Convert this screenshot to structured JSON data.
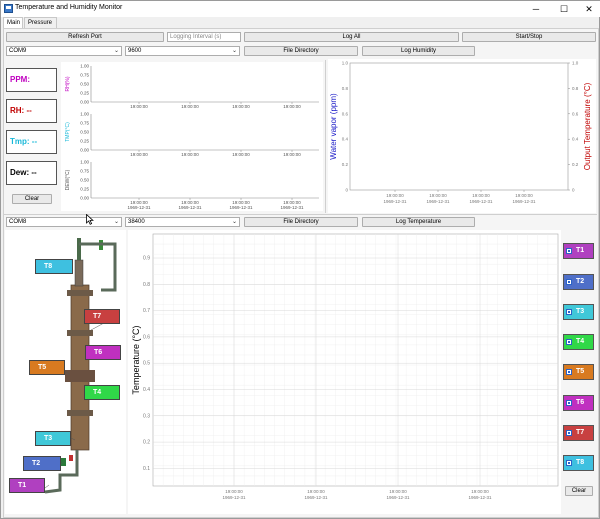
{
  "window": {
    "title": "Temperature and Humidity Monitor",
    "minimize": "─",
    "maximize": "☐",
    "close": "✕"
  },
  "tabs": [
    {
      "label": "Main"
    },
    {
      "label": "Pressure"
    }
  ],
  "toolbar": {
    "refresh_port": "Refresh Port",
    "logging_interval_placeholder": "Logging Interval (s)",
    "log_all": "Log All",
    "start_stop": "Start/Stop"
  },
  "humidity": {
    "port": "COM9",
    "baud": "9600",
    "file_directory": "File Directory",
    "log_button": "Log Humidity",
    "readouts": [
      {
        "label": "PPM:",
        "color": "#c000c0"
      },
      {
        "label": "RH: --",
        "color": "#c00000"
      },
      {
        "label": "Tmp: --",
        "color": "#18b8d8"
      },
      {
        "label": "Dew: --",
        "color": "#000000"
      }
    ],
    "clear": "Clear",
    "small_plots": [
      {
        "ylabel": "RH(%)",
        "ylabel_color": "#c000c0",
        "yticks": [
          "1.00",
          "0.75",
          "0.50",
          "0.25",
          "0.00"
        ],
        "xticks": [
          "19:00:00",
          "19:00:00",
          "19:00:00",
          "19:00:00"
        ],
        "xdate": ""
      },
      {
        "ylabel": "TMP(°C)",
        "ylabel_color": "#18b8d8",
        "yticks": [
          "1.00",
          "0.75",
          "0.50",
          "0.25",
          "0.00"
        ],
        "xticks": [
          "19:00:00",
          "19:00:00",
          "19:00:00",
          "19:00:00"
        ],
        "xdate": ""
      },
      {
        "ylabel": "DEW(°C)",
        "ylabel_color": "#555555",
        "yticks": [
          "1.00",
          "0.75",
          "0.50",
          "0.25",
          "0.00"
        ],
        "xticks": [
          "19:00:00",
          "19:00:00",
          "19:00:00",
          "19:00:00"
        ],
        "xdate": "1969-12-31"
      }
    ],
    "right_plot": {
      "left_label": "Water vapor (ppm)",
      "left_color": "#1c1cc8",
      "right_label": "Output Temperature (°C)",
      "right_color": "#c00000",
      "yticks_left": [
        "1.0",
        "0.8",
        "0.6",
        "0.4",
        "0.2",
        "0"
      ],
      "yticks_right": [
        "1.0",
        "0.8",
        "0.6",
        "0.4",
        "0.2",
        "0"
      ],
      "xticks": [
        "19:00:00",
        "19:00:00",
        "19:00:00",
        "19:00:00"
      ],
      "xdate": "1969-12-31"
    }
  },
  "temperature": {
    "port": "COM8",
    "baud": "38400",
    "file_directory": "File Directory",
    "log_button": "Log Temperature",
    "ylabel": "Temperature (°C)",
    "yticks": [
      "0.9",
      "0.8",
      "0.7",
      "0.6",
      "0.5",
      "0.4",
      "0.3",
      "0.2",
      "0.1"
    ],
    "xticks": [
      "19:00:00",
      "19:00:00",
      "19:00:00",
      "19:00:00"
    ],
    "xdate": "1969-12-31",
    "clear": "Clear",
    "sensor_labels": [
      {
        "label": "T8",
        "color": "#3ec0e0"
      },
      {
        "label": "T7",
        "color": "#c84040"
      },
      {
        "label": "T6",
        "color": "#c030c0"
      },
      {
        "label": "T5",
        "color": "#d87a20"
      },
      {
        "label": "T4",
        "color": "#30d848"
      },
      {
        "label": "T3",
        "color": "#40c8d8"
      },
      {
        "label": "T2",
        "color": "#4f6fc8"
      },
      {
        "label": "T1",
        "color": "#b040c0"
      }
    ],
    "legend": [
      {
        "label": "T1",
        "color": "#b040c0"
      },
      {
        "label": "T2",
        "color": "#4f6fc8"
      },
      {
        "label": "T3",
        "color": "#40c8d8"
      },
      {
        "label": "T4",
        "color": "#30d848"
      },
      {
        "label": "T5",
        "color": "#d87a20"
      },
      {
        "label": "T6",
        "color": "#c030c0"
      },
      {
        "label": "T7",
        "color": "#c84040"
      },
      {
        "label": "T8",
        "color": "#3ec0e0"
      }
    ]
  }
}
